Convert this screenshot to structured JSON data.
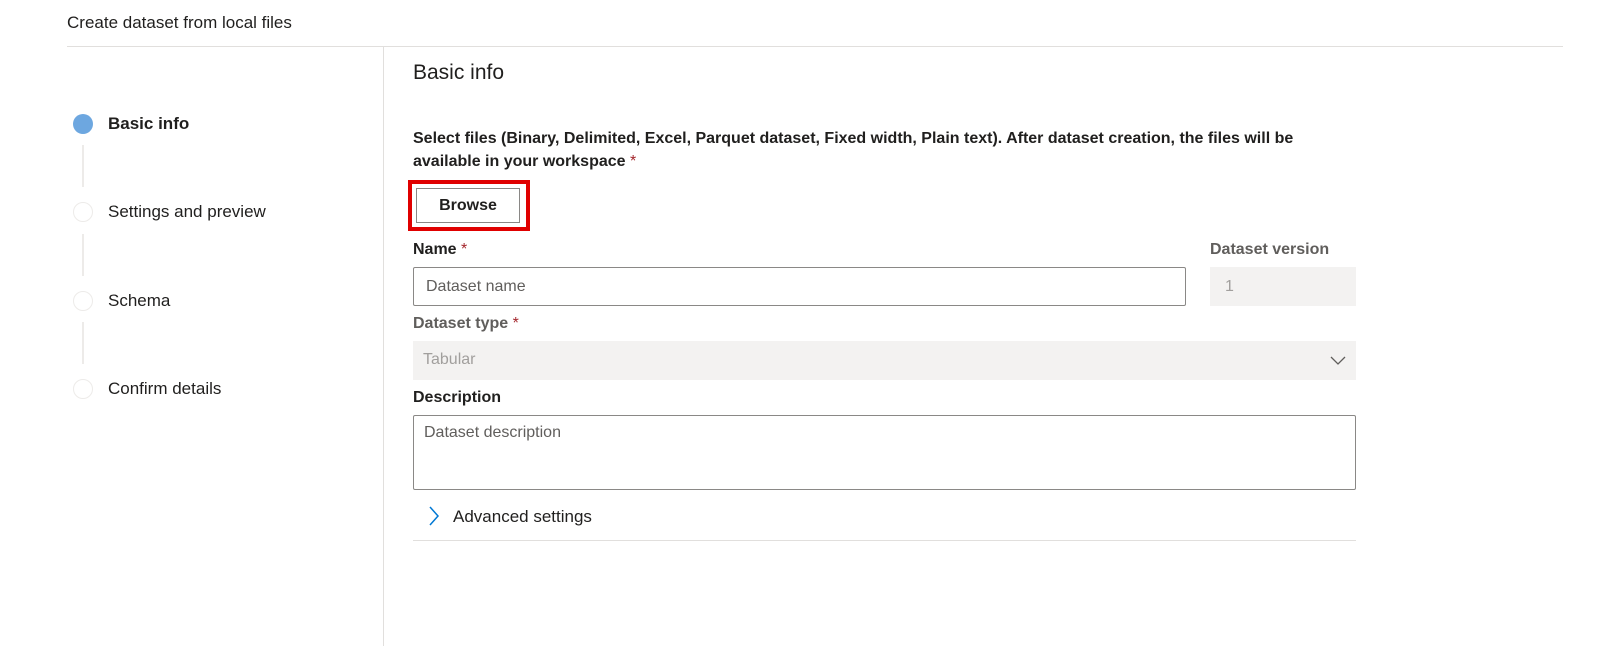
{
  "page": {
    "title": "Create dataset from local files"
  },
  "steps": [
    {
      "label": "Basic info",
      "state": "active"
    },
    {
      "label": "Settings and preview",
      "state": "pending"
    },
    {
      "label": "Schema",
      "state": "pending"
    },
    {
      "label": "Confirm details",
      "state": "pending"
    }
  ],
  "form": {
    "section_title": "Basic info",
    "instructions": "Select files (Binary, Delimited, Excel, Parquet dataset, Fixed width, Plain text). After dataset creation, the files will be available in your workspace",
    "required_marker": "*",
    "browse_label": "Browse",
    "name": {
      "label": "Name",
      "value": "",
      "placeholder": "Dataset name"
    },
    "version": {
      "label": "Dataset version",
      "value": "1"
    },
    "dataset_type": {
      "label": "Dataset type",
      "value": "Tabular",
      "icon": "chevron-down-icon"
    },
    "description": {
      "label": "Description",
      "value": "",
      "placeholder": "Dataset description"
    },
    "advanced": {
      "label": "Advanced settings",
      "icon": "chevron-right-icon"
    }
  },
  "colors": {
    "active_step": "#6da7e0",
    "required": "#a4262c",
    "highlight": "#e00000",
    "chevron": "#0078d4"
  }
}
